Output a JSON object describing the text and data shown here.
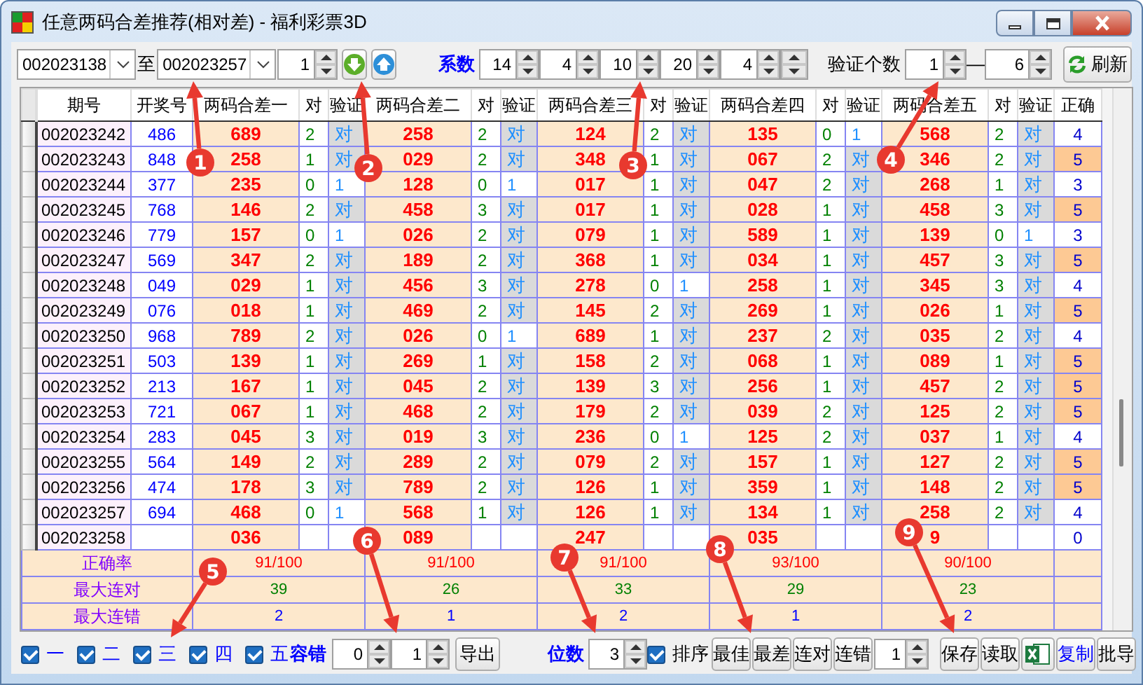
{
  "window": {
    "title": "任意两码合差推荐(相对差) - 福利彩票3D"
  },
  "toolbar": {
    "from_period": "002023138",
    "to_label": "至",
    "to_period": "002023257",
    "step": "1",
    "coef_label": "系数",
    "coefficients": [
      {
        "value": "14"
      },
      {
        "value": "4"
      },
      {
        "value": "10"
      },
      {
        "value": "20"
      },
      {
        "value": "4"
      },
      {
        "kind": "blank"
      }
    ],
    "verify_label": "验证个数",
    "verify_from": "1",
    "dash": "—",
    "verify_to": "6",
    "refresh": "刷新"
  },
  "table": {
    "columns": [
      "期号",
      "开奖号",
      "两码合差一",
      "对",
      "验证",
      "两码合差二",
      "对",
      "验证",
      "两码合差三",
      "对",
      "验证",
      "两码合差四",
      "对",
      "验证",
      "两码合差五",
      "对",
      "验证",
      "正确"
    ],
    "rows": [
      {
        "period": "002023242",
        "draw": "486",
        "groups": [
          {
            "value": "689",
            "count": "2",
            "check": "对",
            "hit": true
          },
          {
            "value": "258",
            "count": "2",
            "check": "对",
            "hit": true
          },
          {
            "value": "124",
            "count": "2",
            "check": "对",
            "hit": true
          },
          {
            "value": "135",
            "count": "0",
            "check": "1",
            "hit": false
          },
          {
            "value": "568",
            "count": "2",
            "check": "对",
            "hit": true
          }
        ],
        "correct": "4",
        "highlight": false
      },
      {
        "period": "002023243",
        "draw": "848",
        "groups": [
          {
            "value": "258",
            "count": "1",
            "check": "对",
            "hit": true
          },
          {
            "value": "029",
            "count": "2",
            "check": "对",
            "hit": true
          },
          {
            "value": "348",
            "count": "1",
            "check": "对",
            "hit": true
          },
          {
            "value": "067",
            "count": "2",
            "check": "对",
            "hit": true
          },
          {
            "value": "346",
            "count": "2",
            "check": "对",
            "hit": true
          }
        ],
        "correct": "5",
        "highlight": true
      },
      {
        "period": "002023244",
        "draw": "377",
        "groups": [
          {
            "value": "235",
            "count": "0",
            "check": "1",
            "hit": false
          },
          {
            "value": "128",
            "count": "0",
            "check": "1",
            "hit": false
          },
          {
            "value": "017",
            "count": "1",
            "check": "对",
            "hit": true
          },
          {
            "value": "047",
            "count": "2",
            "check": "对",
            "hit": true
          },
          {
            "value": "268",
            "count": "1",
            "check": "对",
            "hit": true
          }
        ],
        "correct": "3",
        "highlight": false
      },
      {
        "period": "002023245",
        "draw": "768",
        "groups": [
          {
            "value": "146",
            "count": "2",
            "check": "对",
            "hit": true
          },
          {
            "value": "458",
            "count": "3",
            "check": "对",
            "hit": true
          },
          {
            "value": "017",
            "count": "1",
            "check": "对",
            "hit": true
          },
          {
            "value": "028",
            "count": "1",
            "check": "对",
            "hit": true
          },
          {
            "value": "458",
            "count": "3",
            "check": "对",
            "hit": true
          }
        ],
        "correct": "5",
        "highlight": true
      },
      {
        "period": "002023246",
        "draw": "779",
        "groups": [
          {
            "value": "157",
            "count": "0",
            "check": "1",
            "hit": false
          },
          {
            "value": "026",
            "count": "2",
            "check": "对",
            "hit": true
          },
          {
            "value": "079",
            "count": "1",
            "check": "对",
            "hit": true
          },
          {
            "value": "589",
            "count": "1",
            "check": "对",
            "hit": true
          },
          {
            "value": "139",
            "count": "0",
            "check": "1",
            "hit": false
          }
        ],
        "correct": "3",
        "highlight": false
      },
      {
        "period": "002023247",
        "draw": "569",
        "groups": [
          {
            "value": "347",
            "count": "2",
            "check": "对",
            "hit": true
          },
          {
            "value": "189",
            "count": "2",
            "check": "对",
            "hit": true
          },
          {
            "value": "368",
            "count": "1",
            "check": "对",
            "hit": true
          },
          {
            "value": "034",
            "count": "1",
            "check": "对",
            "hit": true
          },
          {
            "value": "457",
            "count": "3",
            "check": "对",
            "hit": true
          }
        ],
        "correct": "5",
        "highlight": true
      },
      {
        "period": "002023248",
        "draw": "049",
        "groups": [
          {
            "value": "029",
            "count": "1",
            "check": "对",
            "hit": true
          },
          {
            "value": "456",
            "count": "3",
            "check": "对",
            "hit": true
          },
          {
            "value": "278",
            "count": "0",
            "check": "1",
            "hit": false
          },
          {
            "value": "258",
            "count": "1",
            "check": "对",
            "hit": true
          },
          {
            "value": "345",
            "count": "3",
            "check": "对",
            "hit": true
          }
        ],
        "correct": "4",
        "highlight": false
      },
      {
        "period": "002023249",
        "draw": "076",
        "groups": [
          {
            "value": "018",
            "count": "1",
            "check": "对",
            "hit": true
          },
          {
            "value": "469",
            "count": "2",
            "check": "对",
            "hit": true
          },
          {
            "value": "145",
            "count": "2",
            "check": "对",
            "hit": true
          },
          {
            "value": "269",
            "count": "1",
            "check": "对",
            "hit": true
          },
          {
            "value": "026",
            "count": "1",
            "check": "对",
            "hit": true
          }
        ],
        "correct": "5",
        "highlight": true
      },
      {
        "period": "002023250",
        "draw": "968",
        "groups": [
          {
            "value": "789",
            "count": "2",
            "check": "对",
            "hit": true
          },
          {
            "value": "026",
            "count": "0",
            "check": "1",
            "hit": false
          },
          {
            "value": "689",
            "count": "1",
            "check": "对",
            "hit": true
          },
          {
            "value": "237",
            "count": "2",
            "check": "对",
            "hit": true
          },
          {
            "value": "035",
            "count": "2",
            "check": "对",
            "hit": true
          }
        ],
        "correct": "4",
        "highlight": false
      },
      {
        "period": "002023251",
        "draw": "503",
        "groups": [
          {
            "value": "139",
            "count": "1",
            "check": "对",
            "hit": true
          },
          {
            "value": "269",
            "count": "1",
            "check": "对",
            "hit": true
          },
          {
            "value": "158",
            "count": "2",
            "check": "对",
            "hit": true
          },
          {
            "value": "068",
            "count": "1",
            "check": "对",
            "hit": true
          },
          {
            "value": "089",
            "count": "1",
            "check": "对",
            "hit": true
          }
        ],
        "correct": "5",
        "highlight": true
      },
      {
        "period": "002023252",
        "draw": "213",
        "groups": [
          {
            "value": "167",
            "count": "1",
            "check": "对",
            "hit": true
          },
          {
            "value": "045",
            "count": "2",
            "check": "对",
            "hit": true
          },
          {
            "value": "139",
            "count": "3",
            "check": "对",
            "hit": true
          },
          {
            "value": "256",
            "count": "1",
            "check": "对",
            "hit": true
          },
          {
            "value": "457",
            "count": "2",
            "check": "对",
            "hit": true
          }
        ],
        "correct": "5",
        "highlight": true
      },
      {
        "period": "002023253",
        "draw": "721",
        "groups": [
          {
            "value": "067",
            "count": "1",
            "check": "对",
            "hit": true
          },
          {
            "value": "468",
            "count": "2",
            "check": "对",
            "hit": true
          },
          {
            "value": "179",
            "count": "2",
            "check": "对",
            "hit": true
          },
          {
            "value": "039",
            "count": "2",
            "check": "对",
            "hit": true
          },
          {
            "value": "125",
            "count": "2",
            "check": "对",
            "hit": true
          }
        ],
        "correct": "5",
        "highlight": true
      },
      {
        "period": "002023254",
        "draw": "283",
        "groups": [
          {
            "value": "045",
            "count": "3",
            "check": "对",
            "hit": true
          },
          {
            "value": "019",
            "count": "3",
            "check": "对",
            "hit": true
          },
          {
            "value": "236",
            "count": "0",
            "check": "1",
            "hit": false
          },
          {
            "value": "125",
            "count": "2",
            "check": "对",
            "hit": true
          },
          {
            "value": "037",
            "count": "1",
            "check": "对",
            "hit": true
          }
        ],
        "correct": "4",
        "highlight": false
      },
      {
        "period": "002023255",
        "draw": "564",
        "groups": [
          {
            "value": "149",
            "count": "2",
            "check": "对",
            "hit": true
          },
          {
            "value": "289",
            "count": "2",
            "check": "对",
            "hit": true
          },
          {
            "value": "079",
            "count": "2",
            "check": "对",
            "hit": true
          },
          {
            "value": "157",
            "count": "1",
            "check": "对",
            "hit": true
          },
          {
            "value": "127",
            "count": "2",
            "check": "对",
            "hit": true
          }
        ],
        "correct": "5",
        "highlight": true
      },
      {
        "period": "002023256",
        "draw": "474",
        "groups": [
          {
            "value": "178",
            "count": "3",
            "check": "对",
            "hit": true
          },
          {
            "value": "789",
            "count": "2",
            "check": "对",
            "hit": true
          },
          {
            "value": "126",
            "count": "1",
            "check": "对",
            "hit": true
          },
          {
            "value": "359",
            "count": "1",
            "check": "对",
            "hit": true
          },
          {
            "value": "148",
            "count": "2",
            "check": "对",
            "hit": true
          }
        ],
        "correct": "5",
        "highlight": true
      },
      {
        "period": "002023257",
        "draw": "694",
        "groups": [
          {
            "value": "468",
            "count": "0",
            "check": "1",
            "hit": false
          },
          {
            "value": "568",
            "count": "1",
            "check": "对",
            "hit": true
          },
          {
            "value": "126",
            "count": "1",
            "check": "对",
            "hit": true
          },
          {
            "value": "134",
            "count": "1",
            "check": "对",
            "hit": true
          },
          {
            "value": "258",
            "count": "2",
            "check": "对",
            "hit": true
          }
        ],
        "correct": "4",
        "highlight": false
      },
      {
        "period": "002023258",
        "groups": [
          {
            "value": "036"
          },
          {
            "value": "089"
          },
          {
            "value": "247"
          },
          {
            "value": "035"
          },
          {
            "value": "9"
          }
        ],
        "correct": "0",
        "highlight": false
      }
    ],
    "summary": [
      {
        "label": "正确率",
        "color": "#ff0000",
        "values": [
          "91/100",
          "91/100",
          "91/100",
          "93/100",
          "90/100"
        ]
      },
      {
        "label": "最大连对",
        "color": "#008000",
        "values": [
          "39",
          "26",
          "33",
          "29",
          "23"
        ]
      },
      {
        "label": "最大连错",
        "color": "#0000ff",
        "values": [
          "2",
          "1",
          "2",
          "1",
          "2"
        ]
      }
    ]
  },
  "bottom": {
    "groups": [
      {
        "label": "一",
        "checked": true
      },
      {
        "label": "二",
        "checked": true
      },
      {
        "label": "三",
        "checked": true
      },
      {
        "label": "四",
        "checked": true
      },
      {
        "label": "五",
        "checked": true
      }
    ],
    "tolerance_label": "容错",
    "tolerance_from": "0",
    "tolerance_to": "1",
    "export": "导出",
    "digits_label": "位数",
    "digits": "3",
    "sort": {
      "label": "排序",
      "checked": true
    },
    "buttons": [
      "最佳",
      "最差",
      "连对",
      "连错"
    ],
    "count": "1",
    "save": "保存",
    "load": "读取",
    "copy": "复制",
    "batch": "批导"
  },
  "callouts": [
    {
      "number": "1"
    },
    {
      "number": "2"
    },
    {
      "number": "3"
    },
    {
      "number": "4"
    },
    {
      "number": "5"
    },
    {
      "number": "6"
    },
    {
      "number": "7"
    },
    {
      "number": "8"
    },
    {
      "number": "9"
    }
  ]
}
